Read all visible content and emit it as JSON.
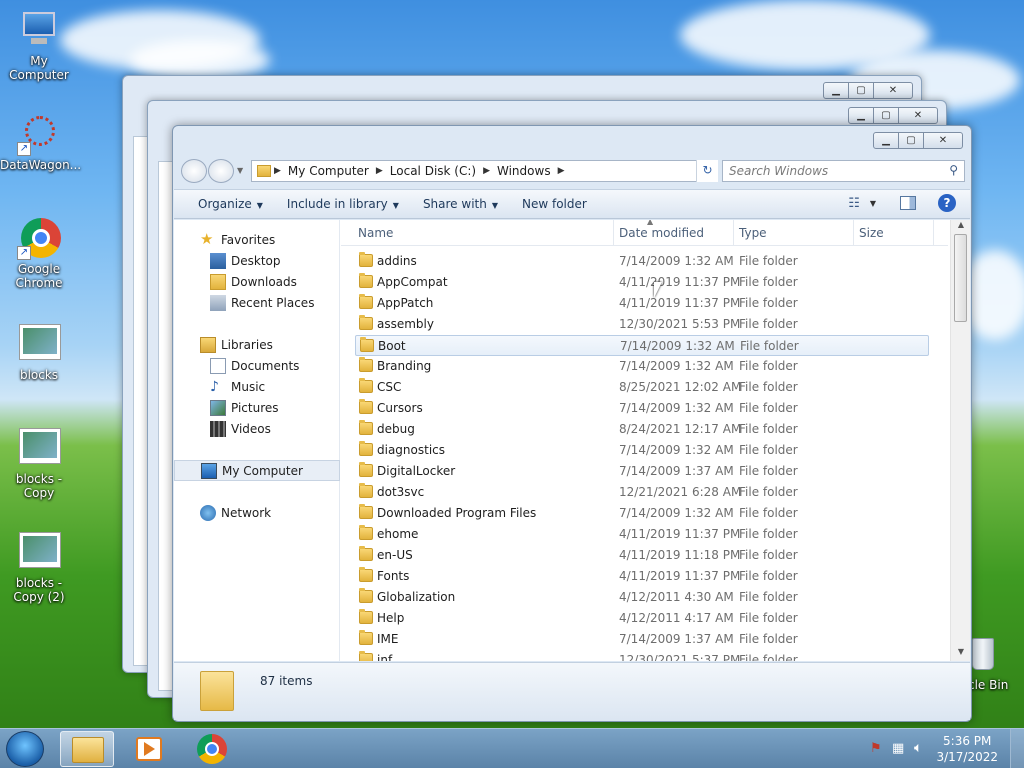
{
  "desktop": {
    "icons": [
      {
        "label": "My Computer"
      },
      {
        "label": "DataWagon..."
      },
      {
        "label": "Google Chrome"
      },
      {
        "label": "blocks"
      },
      {
        "label": "blocks - Copy"
      },
      {
        "label": "blocks - Copy (2)"
      },
      {
        "label": "cle Bin"
      }
    ]
  },
  "explorer": {
    "address": {
      "crumbs": [
        "My Computer",
        "Local Disk (C:)",
        "Windows"
      ]
    },
    "search_placeholder": "Search Windows",
    "toolbar": {
      "organize": "Organize",
      "include_in_library": "Include in library",
      "share_with": "Share with",
      "new_folder": "New folder"
    },
    "nav": {
      "favorites": "Favorites",
      "desktop": "Desktop",
      "downloads": "Downloads",
      "recent_places": "Recent Places",
      "libraries": "Libraries",
      "documents": "Documents",
      "music": "Music",
      "pictures": "Pictures",
      "videos": "Videos",
      "my_computer": "My Computer",
      "network": "Network"
    },
    "columns": {
      "name": "Name",
      "date_modified": "Date modified",
      "type": "Type",
      "size": "Size"
    },
    "files": [
      {
        "name": "addins",
        "date": "7/14/2009 1:32 AM",
        "type": "File folder"
      },
      {
        "name": "AppCompat",
        "date": "4/11/2019 11:37 PM",
        "type": "File folder"
      },
      {
        "name": "AppPatch",
        "date": "4/11/2019 11:37 PM",
        "type": "File folder"
      },
      {
        "name": "assembly",
        "date": "12/30/2021 5:53 PM",
        "type": "File folder"
      },
      {
        "name": "Boot",
        "date": "7/14/2009 1:32 AM",
        "type": "File folder"
      },
      {
        "name": "Branding",
        "date": "7/14/2009 1:32 AM",
        "type": "File folder"
      },
      {
        "name": "CSC",
        "date": "8/25/2021 12:02 AM",
        "type": "File folder"
      },
      {
        "name": "Cursors",
        "date": "7/14/2009 1:32 AM",
        "type": "File folder"
      },
      {
        "name": "debug",
        "date": "8/24/2021 12:17 AM",
        "type": "File folder"
      },
      {
        "name": "diagnostics",
        "date": "7/14/2009 1:32 AM",
        "type": "File folder"
      },
      {
        "name": "DigitalLocker",
        "date": "7/14/2009 1:37 AM",
        "type": "File folder"
      },
      {
        "name": "dot3svc",
        "date": "12/21/2021 6:28 AM",
        "type": "File folder"
      },
      {
        "name": "Downloaded Program Files",
        "date": "7/14/2009 1:32 AM",
        "type": "File folder"
      },
      {
        "name": "ehome",
        "date": "4/11/2019 11:37 PM",
        "type": "File folder"
      },
      {
        "name": "en-US",
        "date": "4/11/2019 11:18 PM",
        "type": "File folder"
      },
      {
        "name": "Fonts",
        "date": "4/11/2019 11:37 PM",
        "type": "File folder"
      },
      {
        "name": "Globalization",
        "date": "4/12/2011 4:30 AM",
        "type": "File folder"
      },
      {
        "name": "Help",
        "date": "4/12/2011 4:17 AM",
        "type": "File folder"
      },
      {
        "name": "IME",
        "date": "7/14/2009 1:37 AM",
        "type": "File folder"
      },
      {
        "name": "inf",
        "date": "12/30/2021 5:37 PM",
        "type": "File folder"
      }
    ],
    "status": "87 items"
  },
  "taskbar": {
    "time": "5:36 PM",
    "date": "3/17/2022"
  }
}
